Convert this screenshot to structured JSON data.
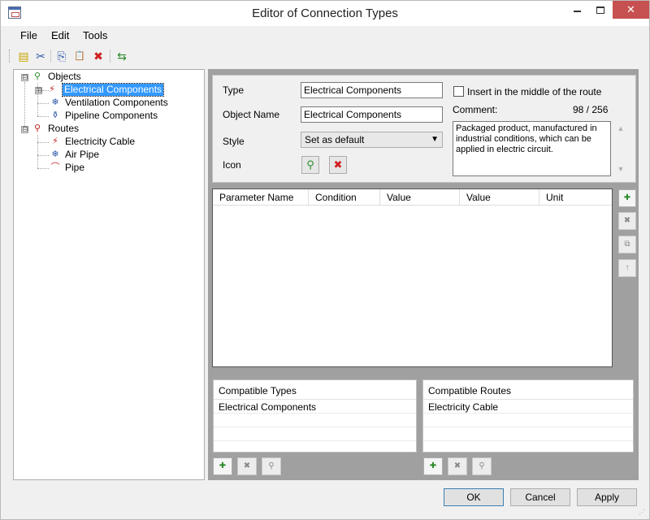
{
  "window": {
    "title": "Editor of Connection Types",
    "minimize_icon": "minimize-icon",
    "maximize_icon": "maximize-icon",
    "close_glyph": "✕"
  },
  "menu": [
    "File",
    "Edit",
    "Tools"
  ],
  "toolbar": {
    "icons": [
      "new-type-icon",
      "cut-icon",
      "copy-icon",
      "paste-icon",
      "delete-icon",
      "move-icon"
    ],
    "glyphs": [
      "▤",
      "✂",
      "⎘",
      "📋",
      "✖",
      "⇆"
    ]
  },
  "tree": {
    "objects_label": "Objects",
    "objects_children": [
      "Electrical Components",
      "Ventilation Components",
      "Pipeline Components"
    ],
    "routes_label": "Routes",
    "routes_children": [
      "Electricity Cable",
      "Air Pipe",
      "Pipe"
    ],
    "selected": "Electrical Components",
    "expand_glyph": "⊟",
    "collapsed_glyph": "⊞"
  },
  "properties": {
    "type_label": "Type",
    "type_value": "Electrical Components",
    "object_name_label": "Object Name",
    "object_name_value": "Electrical Components",
    "style_label": "Style",
    "style_value": "Set as default",
    "icon_label": "Icon",
    "insert_middle_label": "Insert in the middle of the route",
    "insert_middle_checked": false,
    "comment_label": "Comment:",
    "comment_count": "98 / 256",
    "comment_text": "Packaged product, manufactured in industrial conditions, which can be applied in electric circuit."
  },
  "parameters": {
    "columns": [
      "Parameter Name",
      "Condition",
      "Value",
      "Value",
      "Unit"
    ],
    "rows": []
  },
  "compatible_types": {
    "header": "Compatible Types",
    "rows": [
      "Electrical Components"
    ]
  },
  "compatible_routes": {
    "header": "Compatible Routes",
    "rows": [
      "Electricity Cable"
    ]
  },
  "buttons": {
    "ok": "OK",
    "cancel": "Cancel",
    "apply": "Apply"
  },
  "colors": {
    "selection": "#3399ff",
    "close_button": "#c75050",
    "panel_dark": "#a0a0a0"
  }
}
